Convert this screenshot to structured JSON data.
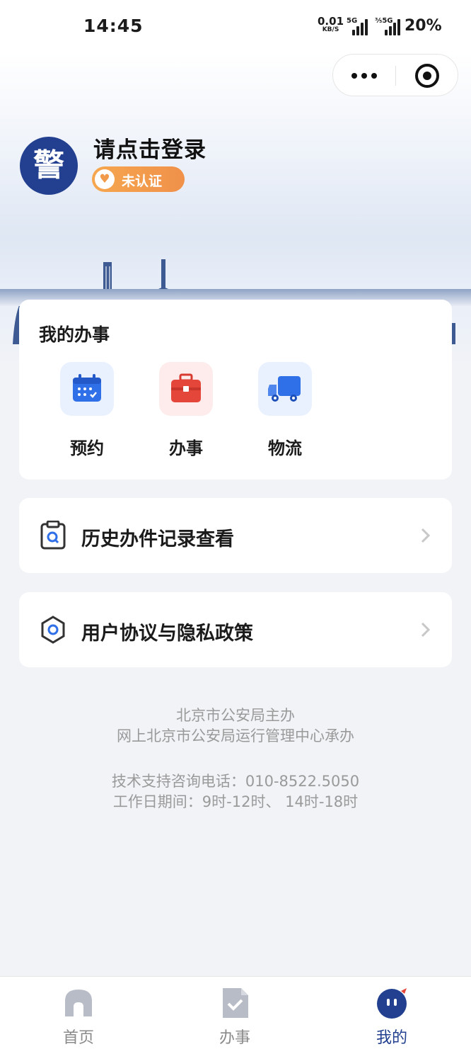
{
  "status_bar": {
    "time": "14:45",
    "net_speed_value": "0.01",
    "net_speed_unit": "KB/S",
    "signal1_gen": "5G",
    "signal2_gen": "⅗5G",
    "battery": "20%"
  },
  "profile": {
    "avatar_text": "警",
    "login_prompt": "请点击登录",
    "cert_status": "未认证"
  },
  "services": {
    "title": "我的办事",
    "items": [
      {
        "label": "预约",
        "icon": "calendar-icon"
      },
      {
        "label": "办事",
        "icon": "briefcase-icon"
      },
      {
        "label": "物流",
        "icon": "truck-icon"
      }
    ]
  },
  "menu": [
    {
      "label": "历史办件记录查看",
      "icon": "clipboard-search-icon"
    },
    {
      "label": "用户协议与隐私政策",
      "icon": "hexagon-icon"
    }
  ],
  "footer": {
    "sponsor": "北京市公安局主办",
    "organizer": "网上北京市公安局运行管理中心承办",
    "phone": "技术支持咨询电话：010-8522.5050",
    "hours": "工作日期间：9时-12时、 14时-18时"
  },
  "tabs": [
    {
      "label": "首页",
      "icon": "home-icon",
      "active": false
    },
    {
      "label": "办事",
      "icon": "document-check-icon",
      "active": false
    },
    {
      "label": "我的",
      "icon": "profile-face-icon",
      "active": true
    }
  ],
  "colors": {
    "brand": "#22408f",
    "badge": "#f0914a",
    "page_bg": "#f1f3f7",
    "active_tab": "#22408f"
  }
}
